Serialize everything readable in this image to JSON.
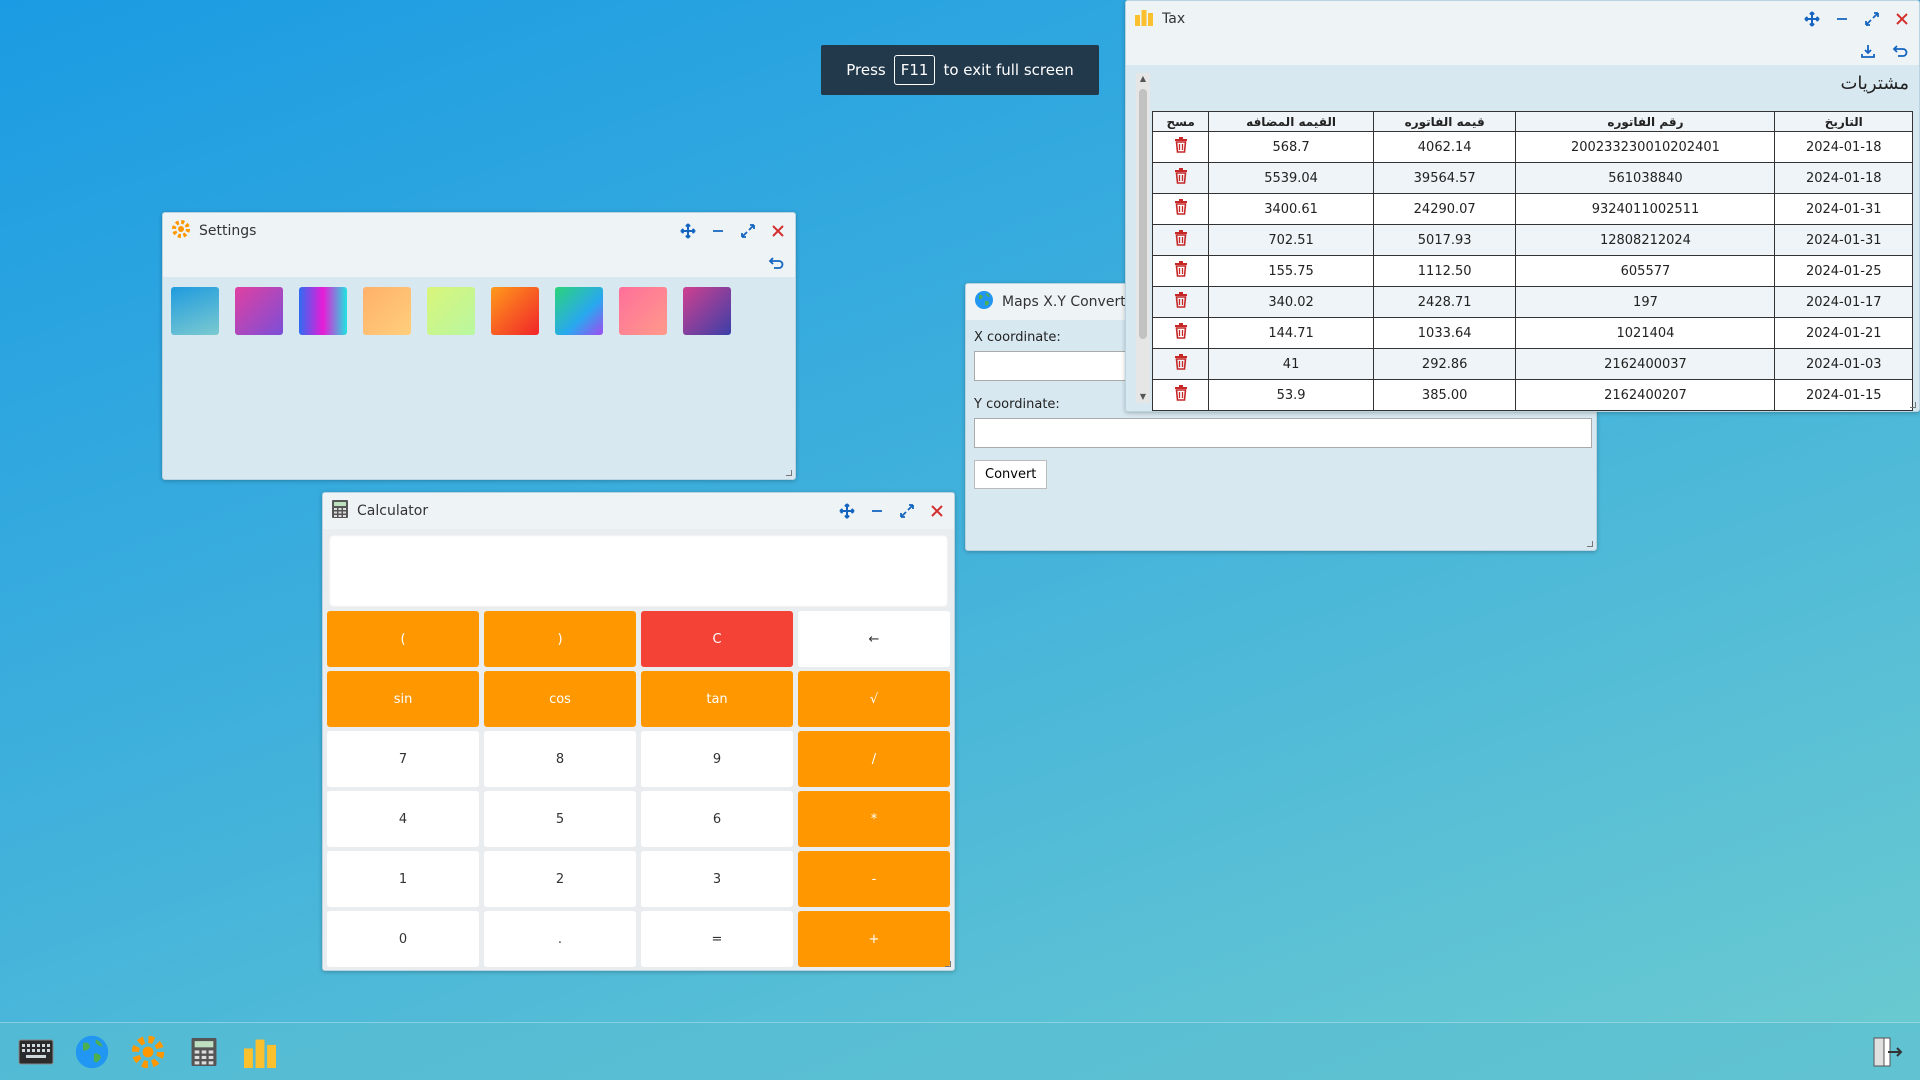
{
  "banner": {
    "press": "Press",
    "key": "F11",
    "rest": "to exit full screen"
  },
  "settings": {
    "title": "Settings",
    "swatches": [
      "linear-gradient(160deg,#1f9bde,#7ccad0)",
      "linear-gradient(135deg,#e040a0,#7b4fd8)",
      "linear-gradient(90deg,#2f6cf2,#e81bd6 50%,#20e4e0)",
      "linear-gradient(135deg,#ffb06a,#ffcf7d)",
      "linear-gradient(135deg,#d9f57a,#b8f7a0)",
      "linear-gradient(135deg,#ff9a1a,#f0242a)",
      "linear-gradient(135deg,#2bd37a,#29a8f0 60%,#a04cf0)",
      "linear-gradient(135deg,#ff6f9a,#ff9a8a)",
      "linear-gradient(135deg,#d04090,#3b3fa8)"
    ]
  },
  "calculator": {
    "title": "Calculator",
    "keys": [
      {
        "label": "(",
        "style": "k-or",
        "name": "open-paren-button"
      },
      {
        "label": ")",
        "style": "k-or",
        "name": "close-paren-button"
      },
      {
        "label": "C",
        "style": "k-red",
        "name": "clear-button"
      },
      {
        "label": "←",
        "style": "k-wh",
        "name": "backspace-button"
      },
      {
        "label": "sin",
        "style": "k-or",
        "name": "sin-button"
      },
      {
        "label": "cos",
        "style": "k-or",
        "name": "cos-button"
      },
      {
        "label": "tan",
        "style": "k-or",
        "name": "tan-button"
      },
      {
        "label": "√",
        "style": "k-or",
        "name": "sqrt-button"
      },
      {
        "label": "7",
        "style": "k-wh",
        "name": "digit-7-button"
      },
      {
        "label": "8",
        "style": "k-wh",
        "name": "digit-8-button"
      },
      {
        "label": "9",
        "style": "k-wh",
        "name": "digit-9-button"
      },
      {
        "label": "/",
        "style": "k-or",
        "name": "divide-button"
      },
      {
        "label": "4",
        "style": "k-wh",
        "name": "digit-4-button"
      },
      {
        "label": "5",
        "style": "k-wh",
        "name": "digit-5-button"
      },
      {
        "label": "6",
        "style": "k-wh",
        "name": "digit-6-button"
      },
      {
        "label": "*",
        "style": "k-or",
        "name": "multiply-button"
      },
      {
        "label": "1",
        "style": "k-wh",
        "name": "digit-1-button"
      },
      {
        "label": "2",
        "style": "k-wh",
        "name": "digit-2-button"
      },
      {
        "label": "3",
        "style": "k-wh",
        "name": "digit-3-button"
      },
      {
        "label": "-",
        "style": "k-or",
        "name": "subtract-button"
      },
      {
        "label": "0",
        "style": "k-wh",
        "name": "digit-0-button"
      },
      {
        "label": ".",
        "style": "k-wh",
        "name": "decimal-button"
      },
      {
        "label": "=",
        "style": "k-wh",
        "name": "equals-button"
      },
      {
        "label": "+",
        "style": "k-or",
        "name": "add-button"
      }
    ]
  },
  "maps": {
    "title": "Maps X.Y Converter",
    "x_label": "X coordinate:",
    "y_label": "Y coordinate:",
    "x_value": "",
    "y_value": "",
    "convert": "Convert"
  },
  "tax": {
    "title": "Tax",
    "heading": "مشتريات",
    "headers": [
      "التاريخ",
      "رقم الفاتوره",
      "قيمه الفاتوره",
      "القيمه المضافه",
      "مسح"
    ],
    "rows": [
      [
        "2024-01-18",
        "200233230010202401",
        "4062.14",
        "568.7"
      ],
      [
        "2024-01-18",
        "561038840",
        "39564.57",
        "5539.04"
      ],
      [
        "2024-01-31",
        "9324011002511",
        "24290.07",
        "3400.61"
      ],
      [
        "2024-01-31",
        "12808212024",
        "5017.93",
        "702.51"
      ],
      [
        "2024-01-25",
        "605577",
        "1112.50",
        "155.75"
      ],
      [
        "2024-01-17",
        "197",
        "2428.71",
        "340.02"
      ],
      [
        "2024-01-21",
        "1021404",
        "1033.64",
        "144.71"
      ],
      [
        "2024-01-03",
        "2162400037",
        "292.86",
        "41"
      ],
      [
        "2024-01-15",
        "2162400207",
        "385.00",
        "53.9"
      ]
    ]
  },
  "colors": {
    "accent": "#ff9800",
    "danger": "#f44336",
    "close": "#d32f2f",
    "ctrl": "#1565c0"
  }
}
